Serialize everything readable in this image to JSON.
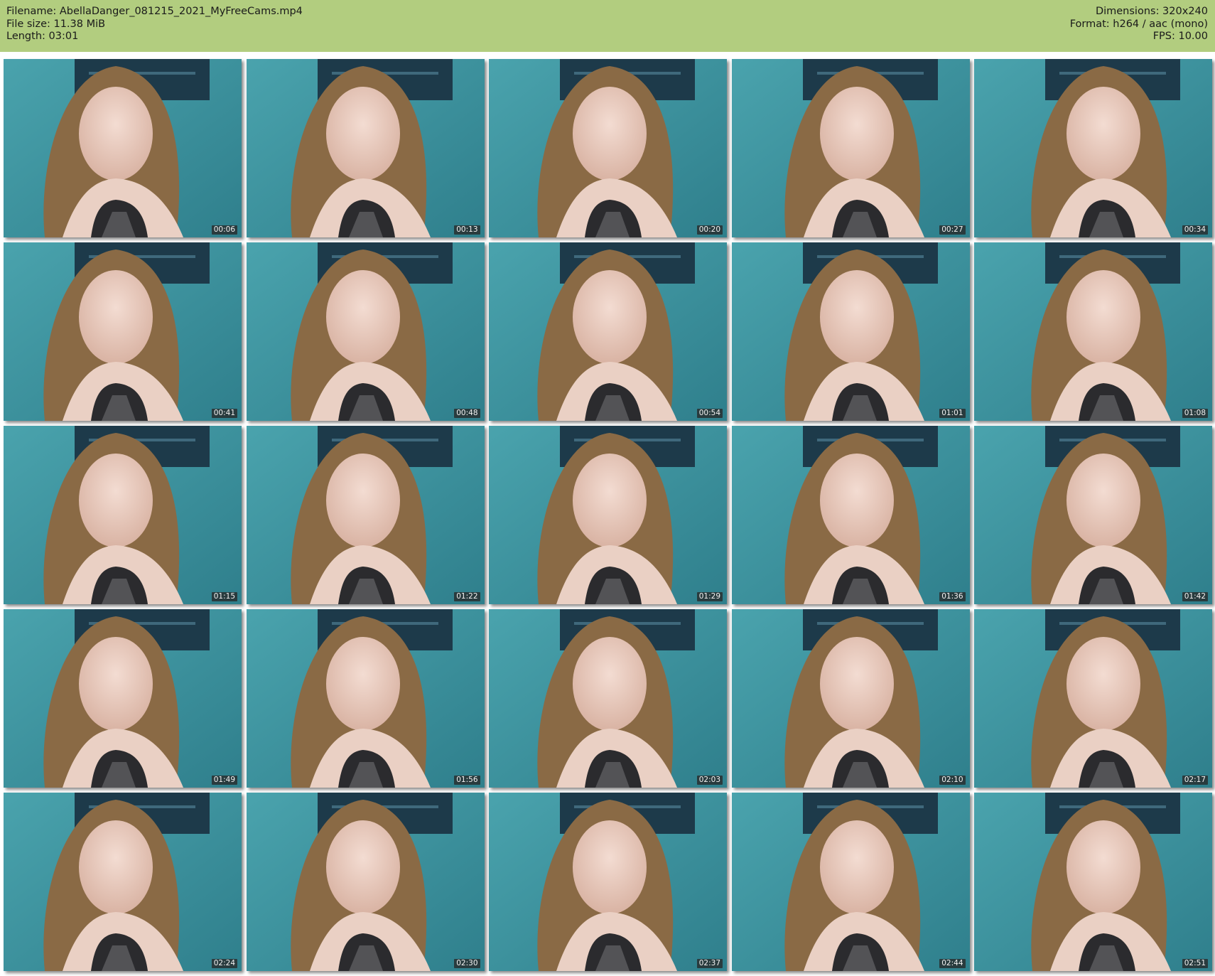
{
  "header": {
    "filename_line": "Filename: AbellaDanger_081215_2021_MyFreeCams.mp4",
    "filesize_line": "File size: 11.38 MiB",
    "length_line": "Length: 03:01",
    "dimensions_line": "Dimensions: 320x240",
    "format_line": "Format: h264 / aac (mono)",
    "fps_line": "FPS: 10.00",
    "background_color": "#b2cd7f"
  },
  "thumbnails": [
    {
      "timestamp": "00:06"
    },
    {
      "timestamp": "00:13"
    },
    {
      "timestamp": "00:20"
    },
    {
      "timestamp": "00:27"
    },
    {
      "timestamp": "00:34"
    },
    {
      "timestamp": "00:41"
    },
    {
      "timestamp": "00:48"
    },
    {
      "timestamp": "00:54"
    },
    {
      "timestamp": "01:01"
    },
    {
      "timestamp": "01:08"
    },
    {
      "timestamp": "01:15"
    },
    {
      "timestamp": "01:22"
    },
    {
      "timestamp": "01:29"
    },
    {
      "timestamp": "01:36"
    },
    {
      "timestamp": "01:42"
    },
    {
      "timestamp": "01:49"
    },
    {
      "timestamp": "01:56"
    },
    {
      "timestamp": "02:03"
    },
    {
      "timestamp": "02:10"
    },
    {
      "timestamp": "02:17"
    },
    {
      "timestamp": "02:24"
    },
    {
      "timestamp": "02:30"
    },
    {
      "timestamp": "02:37"
    },
    {
      "timestamp": "02:44"
    },
    {
      "timestamp": "02:51"
    }
  ]
}
